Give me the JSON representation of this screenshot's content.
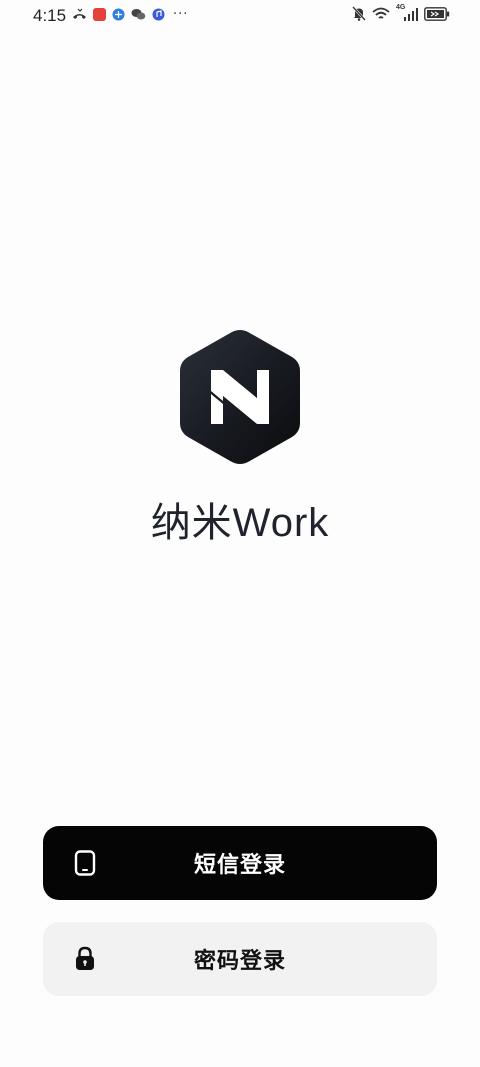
{
  "status_bar": {
    "time": "4:15",
    "network": "4G",
    "icons_left": [
      "missed-call-icon",
      "app-notification-icon",
      "browser-icon",
      "wechat-icon",
      "music-icon"
    ],
    "more": "···",
    "icons_right": [
      "silent-bell-icon",
      "wifi-icon",
      "signal-icon",
      "battery-icon"
    ]
  },
  "brand": {
    "name": "纳米Work",
    "logo_letter": "N",
    "logo_color": "#16191f"
  },
  "buttons": {
    "sms_login": "短信登录",
    "password_login": "密码登录"
  },
  "colors": {
    "primary_button": "#050505",
    "secondary_button": "#f2f2f2",
    "background": "#fdfdfd"
  }
}
